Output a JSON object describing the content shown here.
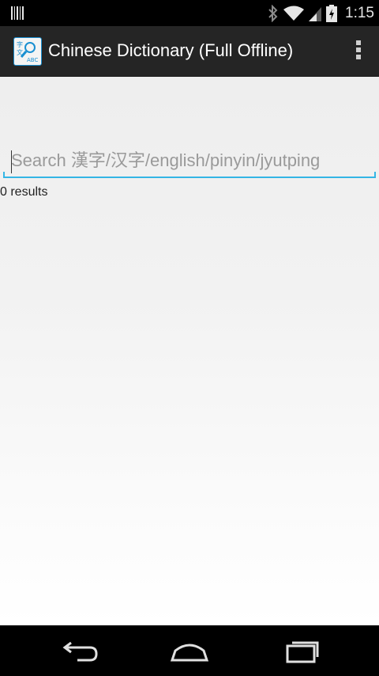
{
  "status_bar": {
    "time": "1:15",
    "icons": [
      "notification-bars-icon",
      "bluetooth-icon",
      "wifi-icon",
      "signal-icon",
      "battery-icon"
    ]
  },
  "action_bar": {
    "title": "Chinese Dictionary (Full Offline)",
    "app_icon": "dictionary-app-icon",
    "overflow_icon": "overflow-menu-icon"
  },
  "search": {
    "placeholder": "Search 漢字/汉字/english/pinyin/jyutping",
    "value": ""
  },
  "results": {
    "count_text": "0 results"
  },
  "nav_bar": {
    "buttons": [
      "back-icon",
      "home-icon",
      "recent-apps-icon"
    ]
  },
  "colors": {
    "accent": "#33b5e5",
    "action_bar_bg": "#252525",
    "status_bar_bg": "#000000"
  }
}
